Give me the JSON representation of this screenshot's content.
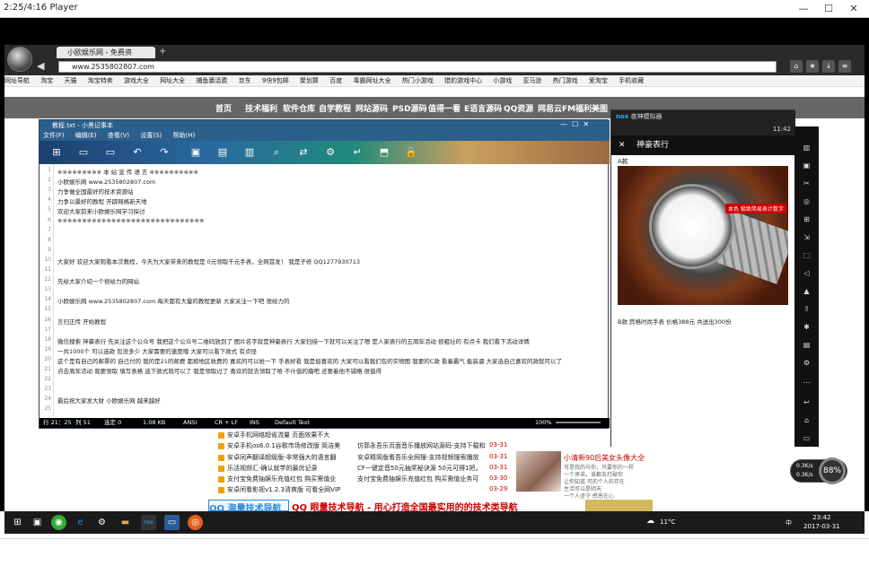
{
  "player": {
    "title": "2:25/4:16 Player",
    "min": "—",
    "max": "☐",
    "close": "✕"
  },
  "browser": {
    "tab_title": "小欧娱乐网 - 免费资",
    "tab_new": "+",
    "address": "www.2535802807.com",
    "bookmarks": [
      "网址导航",
      "淘宝",
      "天猫",
      "淘宝特卖",
      "游戏大全",
      "网址大全",
      "捕鱼赢话费",
      "京东",
      "9块9包邮",
      "聚划算",
      "百度",
      "毒霸网址大全",
      "热门小游戏",
      "猎豹游戏中心",
      "小游戏",
      "亚马逊",
      "热门游戏",
      "爱淘宝",
      "手机收藏"
    ],
    "site_nav": [
      "首页",
      "技术福利",
      "软件仓库",
      "自学教程",
      "网站源码",
      "PSD源码",
      "值得一看",
      "E语言源码",
      "QQ资源",
      "网易云FM",
      "福利美图"
    ]
  },
  "notepad": {
    "title": "教程.txt - 小黑记事本",
    "menu": [
      "文件(F)",
      "编辑(E)",
      "查看(V)",
      "设置(S)",
      "帮助(H)"
    ],
    "lines": [
      {
        "n": "1",
        "t": "※※※※※※※※※ 本 站 宣 传 语 言 ※※※※※※※※※※"
      },
      {
        "n": "2",
        "t": "小欧娱乐网 www.2535802807.com"
      },
      {
        "n": "3",
        "t": "力争做全国最好的技术资源站"
      },
      {
        "n": "4",
        "t": "力争以最好的教程 开辟网络新天地"
      },
      {
        "n": "5",
        "t": "欢迎大家前来小欧娱乐网学习探讨"
      },
      {
        "n": "6",
        "t": "※※※※※※※※※※※※※※※※※※※※※※※※※※※※※※"
      },
      {
        "n": "7",
        "t": ""
      },
      {
        "n": "8",
        "t": ""
      },
      {
        "n": "9",
        "t": ""
      },
      {
        "n": "10",
        "t": "  大家好  欢迎大家观看本次教程，今天为大家带来的教程是  0元领取千元手表，全网首发！  我是子修 QQ1277930713"
      },
      {
        "n": "11",
        "t": ""
      },
      {
        "n": "12",
        "t": "  先给大家介绍一个很给力的网站"
      },
      {
        "n": "13",
        "t": ""
      },
      {
        "n": "14",
        "t": "小欧娱乐网 www.2535802807.com 每天都有大量的教程更新  大家关注一下吧  很给力的"
      },
      {
        "n": "15",
        "t": ""
      },
      {
        "n": "16",
        "t": "  言归正传 开始教程"
      },
      {
        "n": "17",
        "t": ""
      },
      {
        "n": "18",
        "t": "微信搜索  神豪表行 先关注这个公众号   我把这个公众号二维码放到了  图片名字就是神豪表行  大家扫描一下就可以关注了嗯   是人家表行的五周年活动 很粗壮的    有点卡 我们看下活动详情"
      },
      {
        "n": "19",
        "t": "    一共1000个   可以选款  包没多少  大家需要的速度哦  大家可以看下款式  有点怪"
      },
      {
        "n": "20",
        "t": "这个是有自己的邮票的  自己付的  我的是21的邮费  都按地区收费的  喜欢的可以抢一下  手表好看  我是挺喜欢的   大家可以看我们包的实物图 我要的C款 看着霸气  能装逼    大家选自己喜欢的款就可以了"
      },
      {
        "n": "21",
        "t": "点击周年活动  我要领取 填写表格  选下款式就可以了  我是领取过了  喜欢的就去领取了哈  不什值的撸吧  还要着他不错略  很值得"
      },
      {
        "n": "22",
        "t": ""
      },
      {
        "n": "23",
        "t": ""
      },
      {
        "n": "24",
        "t": "最后祝大家发大财 小欧娱乐网  越来越好"
      },
      {
        "n": "25",
        "t": ""
      }
    ],
    "status": {
      "pos": "行 21：25",
      "col": "列 51",
      "sel": "选定 0",
      "size": "1.08 KB",
      "enc": "ANSI",
      "eol": "CR + LF",
      "ins": "INS",
      "style": "Default Text",
      "zoom": "100%"
    }
  },
  "emulator": {
    "title": "夜神模拟器",
    "time": "11:42",
    "app_title": "神豪表行",
    "close": "✕",
    "label_a": "A款",
    "watch_tag": "本色  极致简易表计数字",
    "caption": "B款  宾格时尚手表  价格388元  共送出300份"
  },
  "web": {
    "left_items": [
      {
        "t": "安卓手机网络超省流量 页面效果不大",
        "d": ""
      },
      {
        "t": "安卓手机os6.0.1谷歌市场修改版  简洁美",
        "d": "03-31"
      },
      {
        "t": "安卓同声翻译超级版-非常强大的语言翻",
        "d": "03-31"
      },
      {
        "t": "乐活视频汇-确认就学的最优记录",
        "d": "03-31"
      },
      {
        "t": "支付宝免费抽娱乐充值红包  购买需值业",
        "d": "03-30"
      },
      {
        "t": "安卓闲看影视v1.2.3清爽版  可看全网VIP",
        "d": "03-29"
      }
    ],
    "mid_items": [
      {
        "t": "仿郭永吾乐页面音乐播放网站源码-支持下载和",
        "d": "03-31"
      },
      {
        "t": "安卓精简版看吾乐全网搜-支持视频搜索播放",
        "d": "03-31"
      },
      {
        "t": "CF一键定音50元抽奖秘诀源  50元可得1把，",
        "d": "03-30"
      },
      {
        "t": "支付宝免费抽娱乐充值红包  购买需值业务可",
        "d": "03-30"
      }
    ],
    "right_title": "小清新90后美女头像大全",
    "right_text": [
      "可是我的与你，只要你的一样",
      "一个承诺，谁都去打破你",
      "让你知道 可的个人的存在",
      "生活可以是阴天",
      "一个人坚守 感恩在心"
    ],
    "banner_left": "QQ 海量技术导航",
    "banner_mid": "QQ 眼量技术导航 - 用心打造全国最实用的的技术类导航"
  },
  "taskbar": {
    "temp": "11°C",
    "time": "23:42",
    "date": "2017-03-31",
    "lang": "中"
  },
  "speed": {
    "up": "0.3K/s",
    "down": "0.3K/s",
    "value": "88%"
  }
}
